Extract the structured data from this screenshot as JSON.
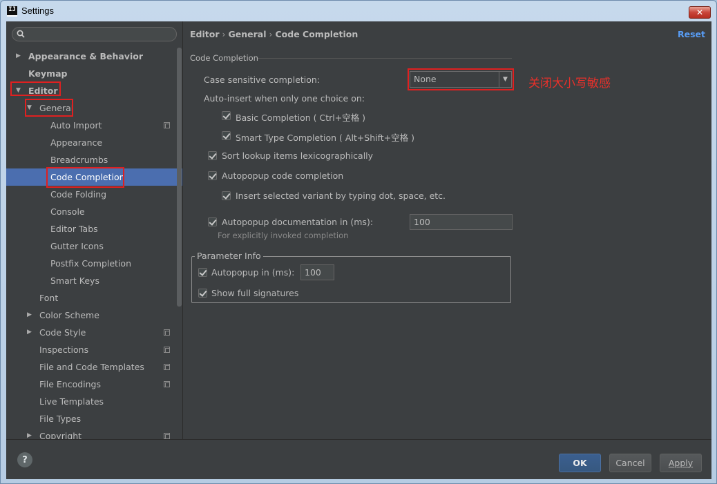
{
  "window": {
    "title": "Settings",
    "app_icon_text": "IJ",
    "close_glyph": "✕"
  },
  "search": {
    "value": "",
    "placeholder": ""
  },
  "tree": [
    {
      "label": "Appearance & Behavior",
      "level": 0,
      "arrow": "▶",
      "bold": true
    },
    {
      "label": "Keymap",
      "level": 0,
      "arrow": "",
      "bold": true
    },
    {
      "label": "Editor",
      "level": 0,
      "arrow": "▼",
      "bold": true
    },
    {
      "label": "General",
      "level": 1,
      "arrow": "▼"
    },
    {
      "label": "Auto Import",
      "level": 2,
      "project_icon": true
    },
    {
      "label": "Appearance",
      "level": 2
    },
    {
      "label": "Breadcrumbs",
      "level": 2
    },
    {
      "label": "Code Completion",
      "level": 2,
      "selected": true
    },
    {
      "label": "Code Folding",
      "level": 2
    },
    {
      "label": "Console",
      "level": 2
    },
    {
      "label": "Editor Tabs",
      "level": 2
    },
    {
      "label": "Gutter Icons",
      "level": 2
    },
    {
      "label": "Postfix Completion",
      "level": 2
    },
    {
      "label": "Smart Keys",
      "level": 2
    },
    {
      "label": "Font",
      "level": 1
    },
    {
      "label": "Color Scheme",
      "level": 1,
      "arrow": "▶"
    },
    {
      "label": "Code Style",
      "level": 1,
      "arrow": "▶",
      "project_icon": true
    },
    {
      "label": "Inspections",
      "level": 1,
      "project_icon": true
    },
    {
      "label": "File and Code Templates",
      "level": 1,
      "project_icon": true
    },
    {
      "label": "File Encodings",
      "level": 1,
      "project_icon": true
    },
    {
      "label": "Live Templates",
      "level": 1
    },
    {
      "label": "File Types",
      "level": 1
    },
    {
      "label": "Copyright",
      "level": 1,
      "arrow": "▶",
      "project_icon": true
    }
  ],
  "breadcrumb": {
    "part1": "Editor",
    "part2": "General",
    "part3": "Code Completion",
    "sep": "›"
  },
  "reset_label": "Reset",
  "section_title": "Code Completion",
  "case_sensitive": {
    "label": "Case sensitive completion:",
    "value": "None"
  },
  "auto_insert_label": "Auto-insert when only one choice on:",
  "basic_completion": "Basic Completion ( Ctrl+空格 )",
  "smart_type_completion": "Smart Type Completion ( Alt+Shift+空格 )",
  "sort_lookup": "Sort lookup items lexicographically",
  "autopopup_code": "Autopopup code completion",
  "insert_selected": "Insert selected variant by typing dot, space, etc.",
  "autopopup_doc": {
    "label": "Autopopup documentation in (ms):",
    "value": "100"
  },
  "doc_hint": "For explicitly invoked completion",
  "param_info": {
    "title": "Parameter Info",
    "autopopup_label": "Autopopup in (ms):",
    "autopopup_value": "100",
    "show_full": "Show full signatures"
  },
  "annotation": "关闭大小写敏感",
  "footer": {
    "help": "?",
    "ok": "OK",
    "cancel": "Cancel",
    "apply": "Apply"
  },
  "colors": {
    "selection": "#4b6eaf",
    "link": "#589df6",
    "annotation": "#e8302a",
    "highlight_box": "#e02020"
  }
}
